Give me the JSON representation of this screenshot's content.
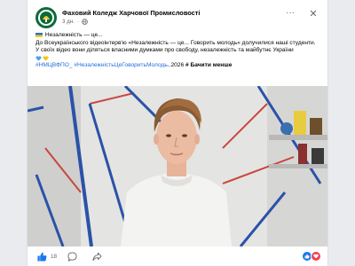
{
  "post": {
    "page_name": "Фаховий Коледж Харчової Промисловості",
    "time": "3 дн.",
    "more_label": "···",
    "close_label": "✕",
    "line1": "Незалежність — це...",
    "line2": "До Всеукраїнського відеоінтерв'ю «Незалежність — це... Говорить молодь» долучилися наші студенти.",
    "line3": "У своїх відео вони діляться власними думками про свободу, незалежність та майбутнє України",
    "hashtag1": "#НМЦВФПО_",
    "hashtag2": "#НезалежністьЦеГоворитьМолодь",
    "hashtag_tail": "..2026",
    "see_less": "# Бачити менше"
  },
  "footer": {
    "like_count": "18"
  },
  "colors": {
    "brand_green": "#0b6b3a",
    "link_blue": "#216fdb",
    "like_blue": "#1877f2",
    "heart_red": "#f33e58"
  },
  "icons": {
    "globe": "globe-icon",
    "like": "thumbs-up-icon",
    "comment": "comment-icon",
    "share": "share-icon"
  }
}
